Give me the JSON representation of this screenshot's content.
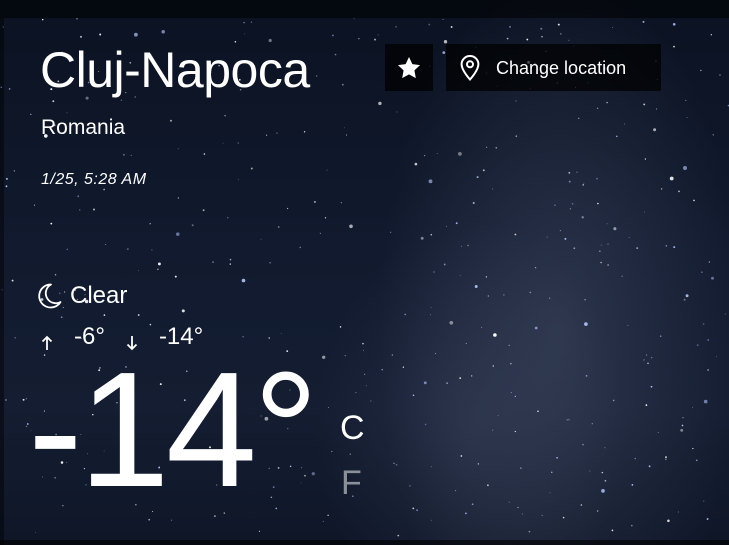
{
  "location": {
    "city": "Cluj-Napoca",
    "country": "Romania",
    "datetime": "1/25, 5:28 AM"
  },
  "actions": {
    "favorite_icon": "star-icon",
    "change_location_icon": "map-pin-icon",
    "change_location_label": "Change location"
  },
  "weather": {
    "condition_icon": "moon-icon",
    "condition": "Clear",
    "high": "-6°",
    "low": "-14°",
    "current_temp": "-14°",
    "units": {
      "celsius": "C",
      "fahrenheit": "F",
      "selected": "C"
    }
  },
  "colors": {
    "text": "#ffffff",
    "inactive_unit": "#8a8f99",
    "button_bg": "#000000"
  }
}
